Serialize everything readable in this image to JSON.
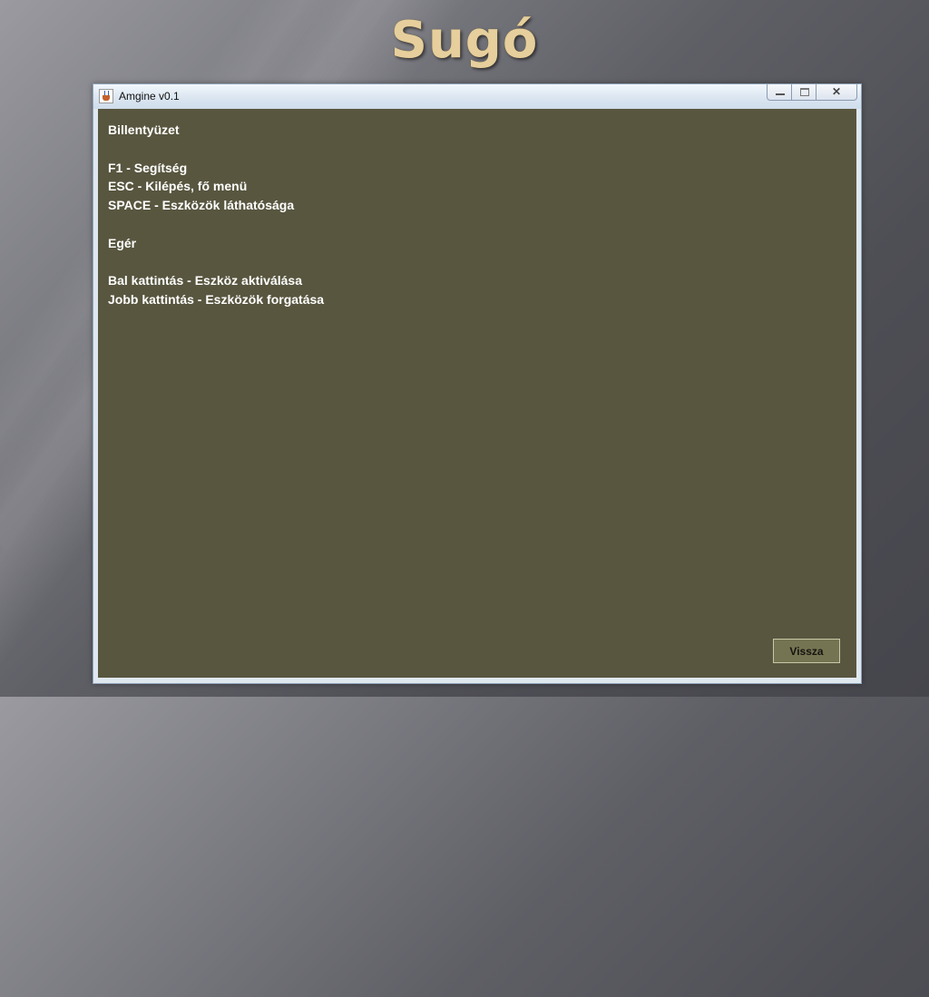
{
  "slide": {
    "title": "Sugó"
  },
  "window": {
    "title": "Amgine v0.1",
    "controls": {
      "minimize": "minimize",
      "maximize": "maximize",
      "close": "✕"
    }
  },
  "help": {
    "keyboard_heading": "Billentyüzet",
    "keys": [
      "F1 - Segítség",
      "ESC - Kilépés, fő menü",
      "SPACE - Eszközök láthatósága"
    ],
    "mouse_heading": "Egér",
    "mouse": [
      "Bal kattintás - Eszköz aktiválása",
      "Jobb kattintás - Eszközök forgatása"
    ]
  },
  "buttons": {
    "back_label": "Vissza"
  }
}
